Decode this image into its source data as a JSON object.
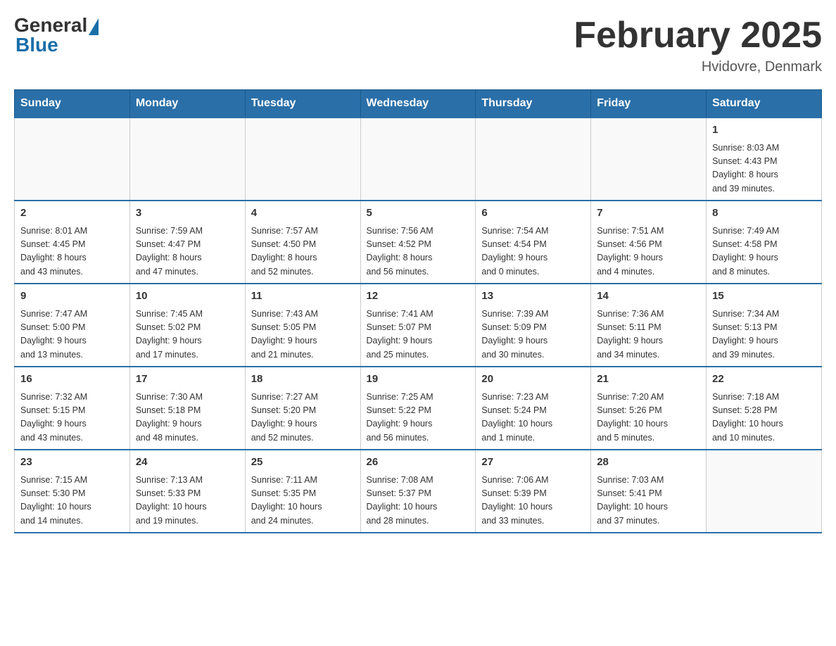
{
  "logo": {
    "general": "General",
    "blue": "Blue"
  },
  "title": "February 2025",
  "location": "Hvidovre, Denmark",
  "weekdays": [
    "Sunday",
    "Monday",
    "Tuesday",
    "Wednesday",
    "Thursday",
    "Friday",
    "Saturday"
  ],
  "weeks": [
    [
      {
        "day": "",
        "info": ""
      },
      {
        "day": "",
        "info": ""
      },
      {
        "day": "",
        "info": ""
      },
      {
        "day": "",
        "info": ""
      },
      {
        "day": "",
        "info": ""
      },
      {
        "day": "",
        "info": ""
      },
      {
        "day": "1",
        "info": "Sunrise: 8:03 AM\nSunset: 4:43 PM\nDaylight: 8 hours\nand 39 minutes."
      }
    ],
    [
      {
        "day": "2",
        "info": "Sunrise: 8:01 AM\nSunset: 4:45 PM\nDaylight: 8 hours\nand 43 minutes."
      },
      {
        "day": "3",
        "info": "Sunrise: 7:59 AM\nSunset: 4:47 PM\nDaylight: 8 hours\nand 47 minutes."
      },
      {
        "day": "4",
        "info": "Sunrise: 7:57 AM\nSunset: 4:50 PM\nDaylight: 8 hours\nand 52 minutes."
      },
      {
        "day": "5",
        "info": "Sunrise: 7:56 AM\nSunset: 4:52 PM\nDaylight: 8 hours\nand 56 minutes."
      },
      {
        "day": "6",
        "info": "Sunrise: 7:54 AM\nSunset: 4:54 PM\nDaylight: 9 hours\nand 0 minutes."
      },
      {
        "day": "7",
        "info": "Sunrise: 7:51 AM\nSunset: 4:56 PM\nDaylight: 9 hours\nand 4 minutes."
      },
      {
        "day": "8",
        "info": "Sunrise: 7:49 AM\nSunset: 4:58 PM\nDaylight: 9 hours\nand 8 minutes."
      }
    ],
    [
      {
        "day": "9",
        "info": "Sunrise: 7:47 AM\nSunset: 5:00 PM\nDaylight: 9 hours\nand 13 minutes."
      },
      {
        "day": "10",
        "info": "Sunrise: 7:45 AM\nSunset: 5:02 PM\nDaylight: 9 hours\nand 17 minutes."
      },
      {
        "day": "11",
        "info": "Sunrise: 7:43 AM\nSunset: 5:05 PM\nDaylight: 9 hours\nand 21 minutes."
      },
      {
        "day": "12",
        "info": "Sunrise: 7:41 AM\nSunset: 5:07 PM\nDaylight: 9 hours\nand 25 minutes."
      },
      {
        "day": "13",
        "info": "Sunrise: 7:39 AM\nSunset: 5:09 PM\nDaylight: 9 hours\nand 30 minutes."
      },
      {
        "day": "14",
        "info": "Sunrise: 7:36 AM\nSunset: 5:11 PM\nDaylight: 9 hours\nand 34 minutes."
      },
      {
        "day": "15",
        "info": "Sunrise: 7:34 AM\nSunset: 5:13 PM\nDaylight: 9 hours\nand 39 minutes."
      }
    ],
    [
      {
        "day": "16",
        "info": "Sunrise: 7:32 AM\nSunset: 5:15 PM\nDaylight: 9 hours\nand 43 minutes."
      },
      {
        "day": "17",
        "info": "Sunrise: 7:30 AM\nSunset: 5:18 PM\nDaylight: 9 hours\nand 48 minutes."
      },
      {
        "day": "18",
        "info": "Sunrise: 7:27 AM\nSunset: 5:20 PM\nDaylight: 9 hours\nand 52 minutes."
      },
      {
        "day": "19",
        "info": "Sunrise: 7:25 AM\nSunset: 5:22 PM\nDaylight: 9 hours\nand 56 minutes."
      },
      {
        "day": "20",
        "info": "Sunrise: 7:23 AM\nSunset: 5:24 PM\nDaylight: 10 hours\nand 1 minute."
      },
      {
        "day": "21",
        "info": "Sunrise: 7:20 AM\nSunset: 5:26 PM\nDaylight: 10 hours\nand 5 minutes."
      },
      {
        "day": "22",
        "info": "Sunrise: 7:18 AM\nSunset: 5:28 PM\nDaylight: 10 hours\nand 10 minutes."
      }
    ],
    [
      {
        "day": "23",
        "info": "Sunrise: 7:15 AM\nSunset: 5:30 PM\nDaylight: 10 hours\nand 14 minutes."
      },
      {
        "day": "24",
        "info": "Sunrise: 7:13 AM\nSunset: 5:33 PM\nDaylight: 10 hours\nand 19 minutes."
      },
      {
        "day": "25",
        "info": "Sunrise: 7:11 AM\nSunset: 5:35 PM\nDaylight: 10 hours\nand 24 minutes."
      },
      {
        "day": "26",
        "info": "Sunrise: 7:08 AM\nSunset: 5:37 PM\nDaylight: 10 hours\nand 28 minutes."
      },
      {
        "day": "27",
        "info": "Sunrise: 7:06 AM\nSunset: 5:39 PM\nDaylight: 10 hours\nand 33 minutes."
      },
      {
        "day": "28",
        "info": "Sunrise: 7:03 AM\nSunset: 5:41 PM\nDaylight: 10 hours\nand 37 minutes."
      },
      {
        "day": "",
        "info": ""
      }
    ]
  ]
}
